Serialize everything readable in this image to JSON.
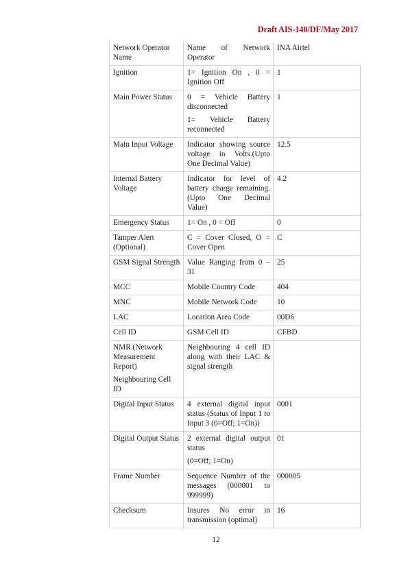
{
  "header": {
    "doc_ref": "Draft AIS-140/DF/May 2017"
  },
  "table": {
    "rows": [
      {
        "field": [
          "Network Operator Name"
        ],
        "description": [
          "Name of Network Operator"
        ],
        "value": "INA Airtel"
      },
      {
        "field": [
          "Ignition"
        ],
        "description": [
          "1= Ignition On , 0 = Ignition Off"
        ],
        "value": "1"
      },
      {
        "field": [
          "Main Power Status"
        ],
        "description": [
          "0 = Vehicle Battery disconnected",
          "1= Vehicle Battery reconnected"
        ],
        "value": "1"
      },
      {
        "field": [
          "Main Input Voltage"
        ],
        "description": [
          "Indicator showing source voltage in Volts.(Upto One Decimal Value)"
        ],
        "value": "12.5"
      },
      {
        "field": [
          "Internal Battery Voltage"
        ],
        "description": [
          "Indicator for level of battery charge remaining. (Upto One Decimal Value)"
        ],
        "value": "4.2"
      },
      {
        "field": [
          "Emergency Status"
        ],
        "description": [
          "1= On , 0 = Off"
        ],
        "value": "0"
      },
      {
        "field": [
          "Tamper Alert (Optional)"
        ],
        "description": [
          "C = Cover Closed, O = Cover Open"
        ],
        "value": "C"
      },
      {
        "field": [
          "GSM Signal Strength"
        ],
        "description": [
          "Value Ranging from 0 – 31"
        ],
        "value": "25"
      },
      {
        "field": [
          "MCC"
        ],
        "description": [
          "Mobile Country Code"
        ],
        "value": "404"
      },
      {
        "field": [
          "MNC"
        ],
        "description": [
          "Mobile Network Code"
        ],
        "value": "10"
      },
      {
        "field": [
          "LAC"
        ],
        "description": [
          "Location Area Code"
        ],
        "value": "00D6"
      },
      {
        "field": [
          "Cell ID"
        ],
        "description": [
          "GSM Cell ID"
        ],
        "value": "CFBD"
      },
      {
        "field": [
          "NMR (Network Measurement Report)",
          "Neighbouring Cell ID"
        ],
        "description": [
          "Neighbouring 4 cell ID along with their LAC & signal strength"
        ],
        "value": ""
      },
      {
        "field": [
          "Digital Input Status"
        ],
        "description": [
          "4 external digital input status (Status of Input 1 to Input 3 (0=Off; 1=On))"
        ],
        "value": "0001"
      },
      {
        "field": [
          "Digital Output Status"
        ],
        "description": [
          "2 external digital output status",
          "(0=Off; 1=On)"
        ],
        "value": "01"
      },
      {
        "field": [
          "Frame Number"
        ],
        "description": [
          "Sequence Number of the messages (000001 to 999999)"
        ],
        "value": "000005"
      },
      {
        "field": [
          "Checksum"
        ],
        "description": [
          "Insures No error in transmission (optimal)"
        ],
        "value": "16"
      }
    ]
  },
  "footer": {
    "page_number": "12"
  }
}
